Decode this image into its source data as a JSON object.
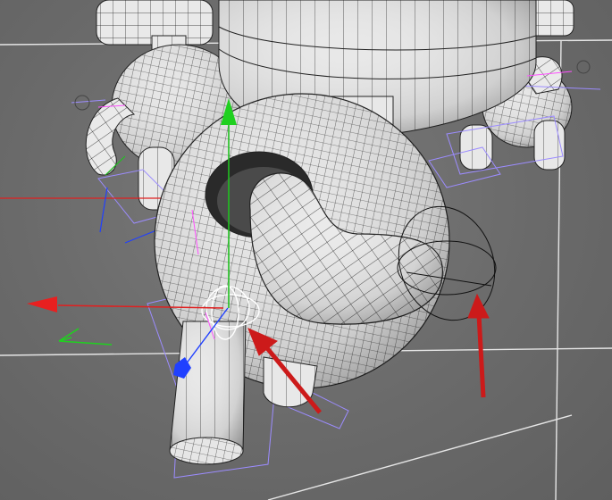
{
  "viewport": {
    "name": "3d-perspective-viewport",
    "background": "#6b6b6b"
  },
  "colors": {
    "floor_grid": "#e6e6e6",
    "wireframe": "#1a1a1a",
    "mesh_fill": "#e8e8e8",
    "mesh_shadow": "#a9a9a9",
    "bounding_box": "#9c8cff",
    "axis_x": "#e02020",
    "axis_y": "#20c020",
    "axis_z": "#2040ff",
    "joint_pink": "#ff50ff",
    "annotation_arrow": "#cc1a1a",
    "hole_dark": "#2a2a2a"
  },
  "icons": {
    "gizmo_y": "y-axis-arrow-icon",
    "gizmo_x": "x-axis-arrow-icon",
    "gizmo_z": "z-axis-cube-icon",
    "world_axis": "world-axis-icon",
    "joint": "joint-crosshair-icon",
    "annotation": "red-arrow-icon"
  },
  "objects": [
    {
      "name": "robot-character-main",
      "type": "subdivision-mesh"
    },
    {
      "name": "robot-character-background-left",
      "type": "subdivision-mesh"
    },
    {
      "name": "robot-character-background-right",
      "type": "subdivision-mesh"
    }
  ],
  "annotations": [
    {
      "name": "arrow-pointing-hip-joint",
      "direction": "up-left"
    },
    {
      "name": "arrow-pointing-rotation-ring",
      "direction": "up"
    }
  ]
}
